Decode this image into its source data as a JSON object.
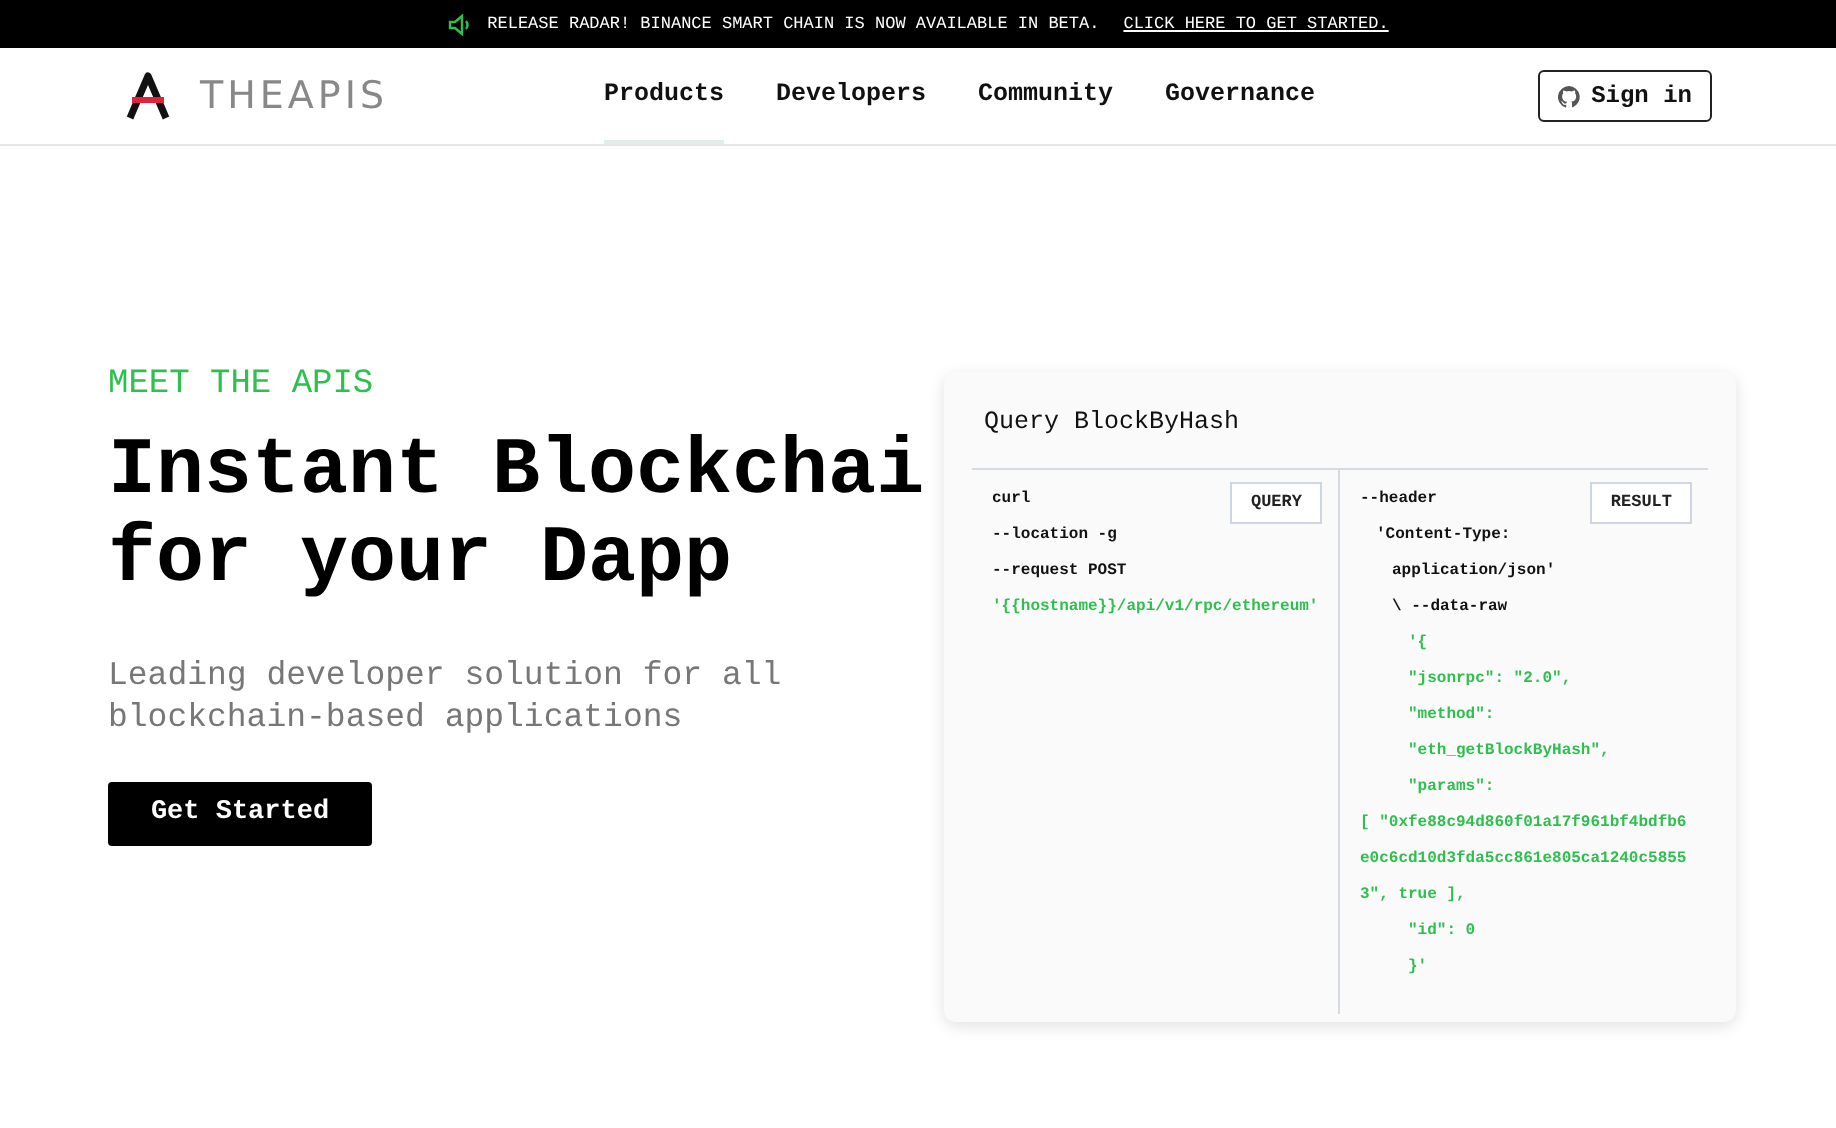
{
  "announcement": {
    "text": "RELEASE RADAR! BINANCE SMART CHAIN IS NOW AVAILABLE IN BETA.",
    "link": "CLICK HERE TO GET STARTED."
  },
  "header": {
    "logo_text": "THEAPIS",
    "nav": [
      {
        "label": "Products",
        "selected": true
      },
      {
        "label": "Developers",
        "selected": false
      },
      {
        "label": "Community",
        "selected": false
      },
      {
        "label": "Governance",
        "selected": false
      }
    ],
    "sign_in": "Sign in"
  },
  "hero": {
    "eyebrow": "MEET THE APIS",
    "title_lines": [
      "Instant Blockchai",
      "for your Dapp"
    ],
    "subtitle": "Leading developer solution for all blockchain-based applications",
    "cta": "Get Started"
  },
  "query_card": {
    "title": "Query BlockByHash",
    "left": {
      "button": "QUERY",
      "lines": [
        {
          "kind": "flag",
          "text": "curl"
        },
        {
          "kind": "flag",
          "text": "--location -g"
        },
        {
          "kind": "flag",
          "text": "--request POST"
        },
        {
          "kind": "url",
          "text": "'{{hostname}}/api/v1/rpc/ethereum'"
        }
      ]
    },
    "right": {
      "button": "RESULT",
      "lines": [
        {
          "kind": "flag",
          "text": "--header"
        },
        {
          "kind": "header",
          "text": "'Content-Type:"
        },
        {
          "kind": "header-cont",
          "text": "application/json'"
        },
        {
          "kind": "header-cont",
          "text": "\\ --data-raw"
        },
        {
          "kind": "body",
          "text": "'{"
        },
        {
          "kind": "body",
          "text": "\"jsonrpc\": \"2.0\","
        },
        {
          "kind": "body",
          "text": "\"method\":"
        },
        {
          "kind": "body",
          "text": "\"eth_getBlockByHash\","
        },
        {
          "kind": "body",
          "text": "\"params\":"
        },
        {
          "kind": "wrap",
          "text": "[ \"0xfe88c94d860f01a17f961bf4bdfb6"
        },
        {
          "kind": "wrap",
          "text": "e0c6cd10d3fda5cc861e805ca1240c5855"
        },
        {
          "kind": "wrap",
          "text": "3\", true ],"
        },
        {
          "kind": "body",
          "text": "\"id\": 0"
        },
        {
          "kind": "body",
          "text": "}'"
        }
      ]
    }
  }
}
